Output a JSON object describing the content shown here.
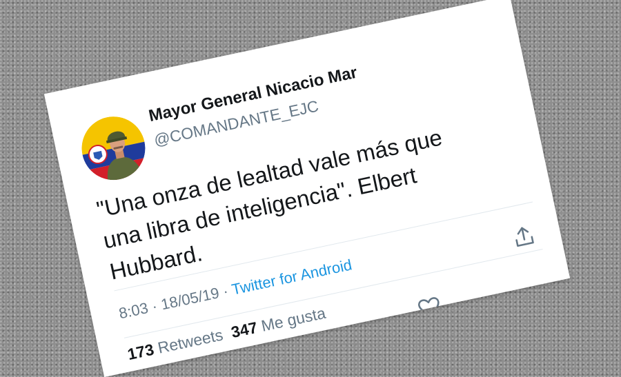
{
  "tweet": {
    "display_name": "Mayor General Nicacio Mar",
    "handle": "@COMANDANTE_EJC",
    "text": "\"Una onza de lealtad vale más que una libra de inteligencia\". Elbert Hubbard.",
    "time": "8:03",
    "separator1": " · ",
    "date": "18/05/19",
    "separator2": " · ",
    "source": "Twitter for Android",
    "retweets_count": "173",
    "retweets_label": "Retweets",
    "likes_count": "347",
    "likes_label": "Me gusta"
  },
  "icons": {
    "share": "share-icon",
    "like": "heart-icon",
    "retweet": "retweet-icon",
    "avatar": "avatar-flag-soldier"
  },
  "colors": {
    "link": "#1b95e0",
    "secondary_text": "#657786",
    "primary_text": "#14171a"
  }
}
